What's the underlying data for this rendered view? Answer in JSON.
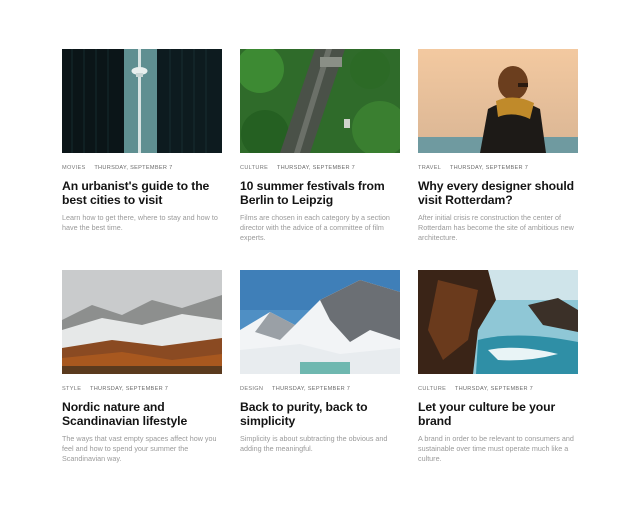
{
  "articles": [
    {
      "category": "Movies",
      "date": "Thursday, September 7",
      "title": "An urbanist's guide to the best cities to visit",
      "excerpt": "Learn how to get there, where to stay and how to have the best time."
    },
    {
      "category": "Culture",
      "date": "Thursday, September 7",
      "title": "10 summer festivals from Berlin to Leipzig",
      "excerpt": "Films are chosen in each category by a section director with the advice of a committee of film experts."
    },
    {
      "category": "Travel",
      "date": "Thursday, September 7",
      "title": "Why every designer should visit Rotterdam?",
      "excerpt": "After initial crisis re construction the center of Rotterdam has become the site of ambitious new architecture."
    },
    {
      "category": "Style",
      "date": "Thursday, September 7",
      "title": "Nordic nature and Scandinavian lifestyle",
      "excerpt": "The ways that vast empty spaces affect how you feel and how to spend your summer the Scandinavian way."
    },
    {
      "category": "Design",
      "date": "Thursday, September 7",
      "title": "Back to purity, back to simplicity",
      "excerpt": "Simplicity is about subtracting the obvious and adding the meaningful."
    },
    {
      "category": "Culture",
      "date": "Thursday, September 7",
      "title": "Let your culture be your brand",
      "excerpt": "A brand in order to be relevant to consumers and sustainable over time must operate much like a culture."
    }
  ]
}
